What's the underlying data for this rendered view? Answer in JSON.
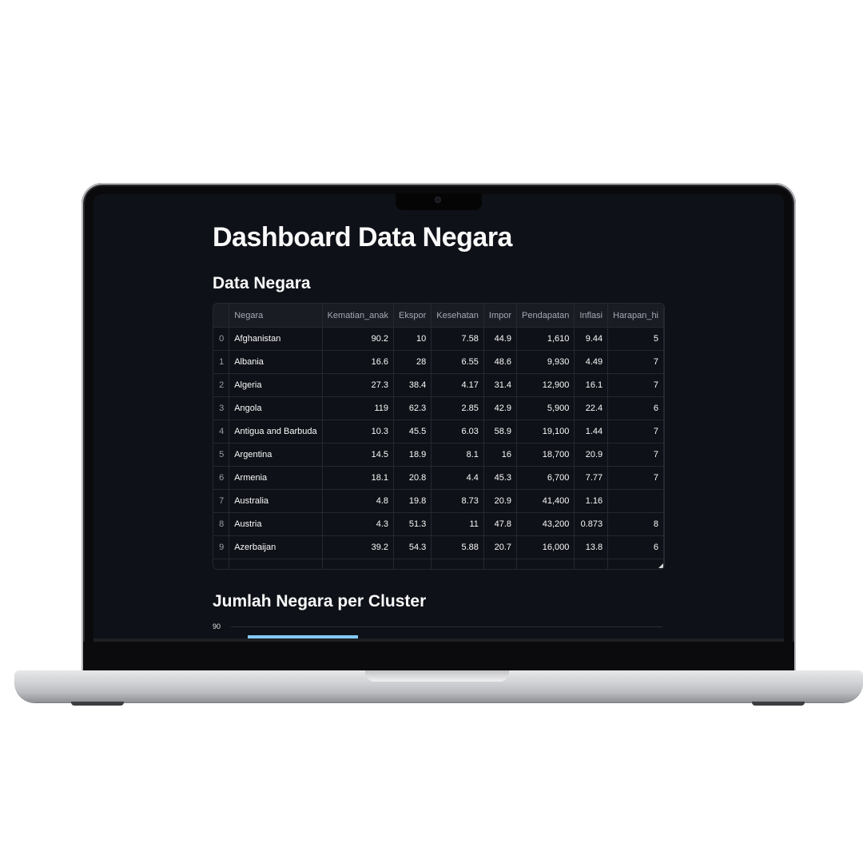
{
  "app": {
    "title": "Dashboard Data Negara",
    "section_table": "Data Negara",
    "section_chart": "Jumlah Negara per Cluster"
  },
  "table": {
    "columns": [
      "",
      "Negara",
      "Kematian_anak",
      "Ekspor",
      "Kesehatan",
      "Impor",
      "Pendapatan",
      "Inflasi",
      "Harapan_hi"
    ],
    "rows": [
      [
        "0",
        "Afghanistan",
        "90.2",
        "10",
        "7.58",
        "44.9",
        "1,610",
        "9.44",
        "5"
      ],
      [
        "1",
        "Albania",
        "16.6",
        "28",
        "6.55",
        "48.6",
        "9,930",
        "4.49",
        "7"
      ],
      [
        "2",
        "Algeria",
        "27.3",
        "38.4",
        "4.17",
        "31.4",
        "12,900",
        "16.1",
        "7"
      ],
      [
        "3",
        "Angola",
        "119",
        "62.3",
        "2.85",
        "42.9",
        "5,900",
        "22.4",
        "6"
      ],
      [
        "4",
        "Antigua and Barbuda",
        "10.3",
        "45.5",
        "6.03",
        "58.9",
        "19,100",
        "1.44",
        "7"
      ],
      [
        "5",
        "Argentina",
        "14.5",
        "18.9",
        "8.1",
        "16",
        "18,700",
        "20.9",
        "7"
      ],
      [
        "6",
        "Armenia",
        "18.1",
        "20.8",
        "4.4",
        "45.3",
        "6,700",
        "7.77",
        "7"
      ],
      [
        "7",
        "Australia",
        "4.8",
        "19.8",
        "8.73",
        "20.9",
        "41,400",
        "1.16",
        ""
      ],
      [
        "8",
        "Austria",
        "4.3",
        "51.3",
        "11",
        "47.8",
        "43,200",
        "0.873",
        "8"
      ],
      [
        "9",
        "Azerbaijan",
        "39.2",
        "54.3",
        "5.88",
        "20.7",
        "16,000",
        "13.8",
        "6"
      ]
    ]
  },
  "chart_data": {
    "type": "bar",
    "title": "Jumlah Negara per Cluster",
    "y_tick_labels": [
      "90"
    ],
    "bar_color": "#83c9ff",
    "visible_bars": [
      {
        "value": 87
      }
    ]
  },
  "colors": {
    "background": "#0e1117",
    "text": "#fafafa",
    "header_bg": "#1a1c24",
    "grid": "#262832",
    "accent": "#83c9ff"
  }
}
